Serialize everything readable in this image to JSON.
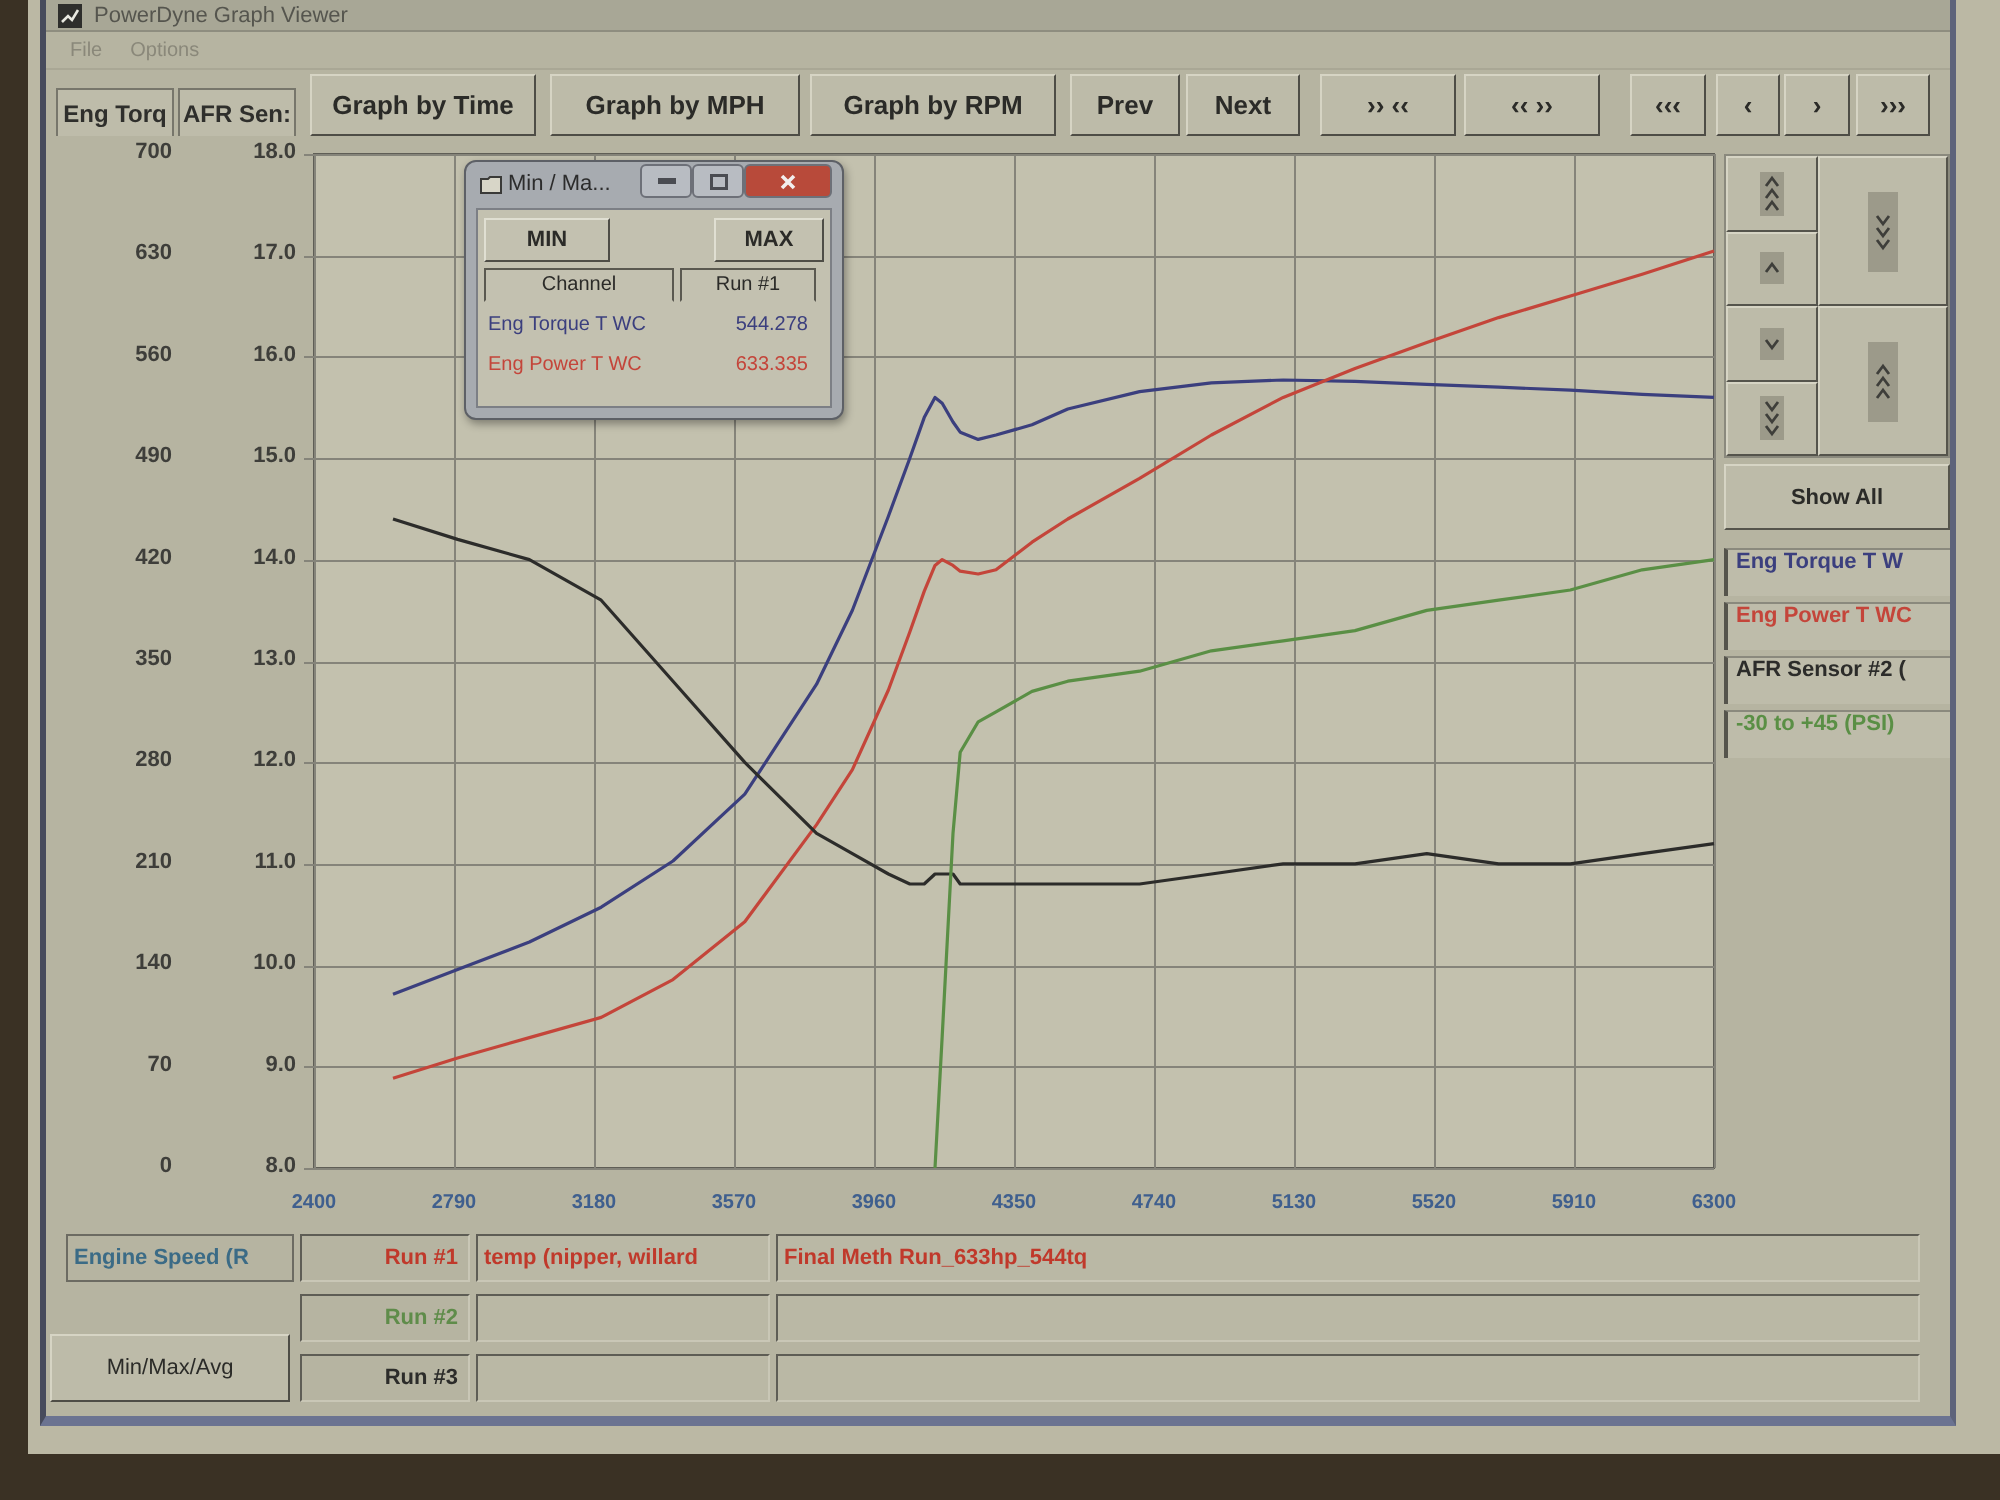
{
  "window": {
    "title": "PowerDyne Graph Viewer"
  },
  "menu": [
    "File",
    "Options"
  ],
  "axis_tabs": [
    {
      "label": "Eng Torq"
    },
    {
      "label": "AFR Sen:"
    }
  ],
  "toolbar": {
    "buttons": [
      "Graph by Time",
      "Graph by MPH",
      "Graph by RPM",
      "Prev",
      "Next",
      "›› ‹‹",
      "‹‹ ››",
      "‹‹‹",
      "‹",
      "›",
      "›››"
    ]
  },
  "chart": {
    "chart_data": {
      "type": "line",
      "grid": true,
      "x": [
        2620,
        2800,
        3000,
        3200,
        3400,
        3600,
        3800,
        3900,
        4000,
        4060,
        4100,
        4130,
        4150,
        4180,
        4200,
        4250,
        4300,
        4400,
        4500,
        4700,
        4900,
        5100,
        5300,
        5500,
        5700,
        5900,
        6100,
        6300
      ],
      "xlim": [
        2400,
        6300
      ],
      "xticks": [
        2400,
        2790,
        3180,
        3570,
        3960,
        4350,
        4740,
        5130,
        5520,
        5910,
        6300
      ],
      "ylim": [
        0,
        700
      ],
      "yticks": [
        0,
        70,
        140,
        210,
        280,
        350,
        420,
        490,
        560,
        630,
        700
      ],
      "series": [
        {
          "name": "Eng Torque T W",
          "color": "#3b3f7e",
          "values": [
            120,
            137,
            156,
            180,
            212,
            258,
            334,
            385,
            450,
            490,
            518,
            532,
            528,
            515,
            508,
            503,
            506,
            513,
            524,
            536,
            542,
            544,
            543,
            541,
            539,
            537,
            534,
            532
          ]
        },
        {
          "name": "Eng Power T WC",
          "color": "#c4453a",
          "values": [
            62,
            76,
            90,
            104,
            130,
            170,
            237,
            275,
            330,
            370,
            398,
            416,
            420,
            416,
            412,
            410,
            413,
            432,
            448,
            476,
            506,
            532,
            552,
            570,
            587,
            602,
            617,
            633
          ]
        }
      ]
    }
  },
  "afr_chart": {
    "chart_data": {
      "type": "line",
      "x": [
        2620,
        2800,
        3000,
        3200,
        3400,
        3600,
        3800,
        3900,
        4000,
        4060,
        4100,
        4130,
        4150,
        4180,
        4200,
        4250,
        4300,
        4400,
        4500,
        4700,
        4900,
        5100,
        5300,
        5500,
        5700,
        5900,
        6100,
        6300
      ],
      "xlim": [
        2400,
        6300
      ],
      "ylim": [
        8,
        18
      ],
      "yticks": [
        {
          "value": 8,
          "label": "8.0"
        },
        {
          "value": 9,
          "label": "9.0"
        },
        {
          "value": 10,
          "label": "10.0"
        },
        {
          "value": 11,
          "label": "11.0"
        },
        {
          "value": 12,
          "label": "12.0"
        },
        {
          "value": 13,
          "label": "13.0"
        },
        {
          "value": 14,
          "label": "14.0"
        },
        {
          "value": 15,
          "label": "15.0"
        },
        {
          "value": 16,
          "label": "16.0"
        },
        {
          "value": 17,
          "label": "17.0"
        },
        {
          "value": 18,
          "label": "18.0"
        }
      ],
      "series": [
        {
          "name": "AFR Sensor #2 (",
          "color": "#2c2c2a",
          "values": [
            14.4,
            14.2,
            14.0,
            13.6,
            12.8,
            12.0,
            11.3,
            11.1,
            10.9,
            10.8,
            10.8,
            10.9,
            10.9,
            10.9,
            10.8,
            10.8,
            10.8,
            10.8,
            10.8,
            10.8,
            10.9,
            11.0,
            11.0,
            11.1,
            11.0,
            11.0,
            11.1,
            11.2
          ]
        }
      ]
    }
  },
  "boost_trace": {
    "name": "-30 to +45 (PSI)",
    "color": "#5a8f45"
  },
  "min_max_dialog": {
    "title": "Min / Ma...",
    "buttons": [
      "MIN",
      "MAX"
    ],
    "columns": [
      "Channel",
      "Run #1"
    ],
    "rows": [
      {
        "channel": "Eng Torque T WC",
        "value": "544.278",
        "color": "#3b3f7e"
      },
      {
        "channel": "Eng Power T WC",
        "value": "633.335",
        "color": "#c4453a"
      }
    ]
  },
  "side_panel": {
    "show_all": "Show All"
  },
  "bottom_panel": {
    "x_channel": "Engine Speed (R",
    "min_max_avg_button": "Min/Max/Avg",
    "runs": [
      {
        "label": "Run #1",
        "color": "#c0392b",
        "text_1": "temp (nipper, willard",
        "text_2": "Final Meth Run_633hp_544tq"
      },
      {
        "label": "Run #2",
        "color": "#5f8c4a"
      },
      {
        "label": "Run #3",
        "color": "#2c2c2a"
      }
    ]
  }
}
